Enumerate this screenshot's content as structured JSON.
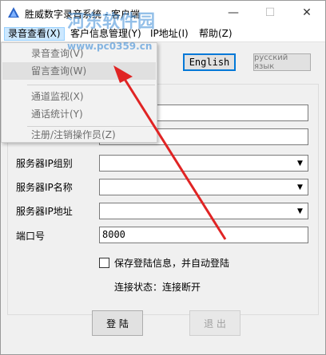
{
  "window": {
    "title": "胜威数字录音系统 - 客户端",
    "min_glyph": "—",
    "max_glyph": "☐",
    "close_glyph": "✕"
  },
  "menu": {
    "items": [
      {
        "label": "录音查看(X)"
      },
      {
        "label": "客户信息管理(Y)"
      },
      {
        "label": "IP地址(I)"
      },
      {
        "label": "帮助(Z)"
      }
    ]
  },
  "dropdown": {
    "items": [
      {
        "label": "录音查询(V)"
      },
      {
        "label": "留言查询(W)"
      },
      {
        "label": "通道监视(X)"
      },
      {
        "label": "通话统计(Y)"
      },
      {
        "label": "注册/注销操作员(Z)"
      }
    ]
  },
  "language": {
    "english": "English",
    "russian": "русский язык"
  },
  "form": {
    "server_group_label": "服务器IP组别",
    "server_name_label": "服务器IP名称",
    "server_address_label": "服务器IP地址",
    "port_label": "端口号",
    "port_value": "8000",
    "save_login_label": "保存登陆信息，并自动登陆",
    "status_label": "连接状态：连接断开",
    "login_button": "登 陆",
    "exit_button": "退 出",
    "combo_arrow": "▼"
  },
  "watermark": {
    "site_name": "河东软件园",
    "site_url": "www.pc0359.cn"
  },
  "colors": {
    "accent": "#0078d7",
    "menu_highlight": "#cce8ff",
    "arrow": "#e02424"
  }
}
